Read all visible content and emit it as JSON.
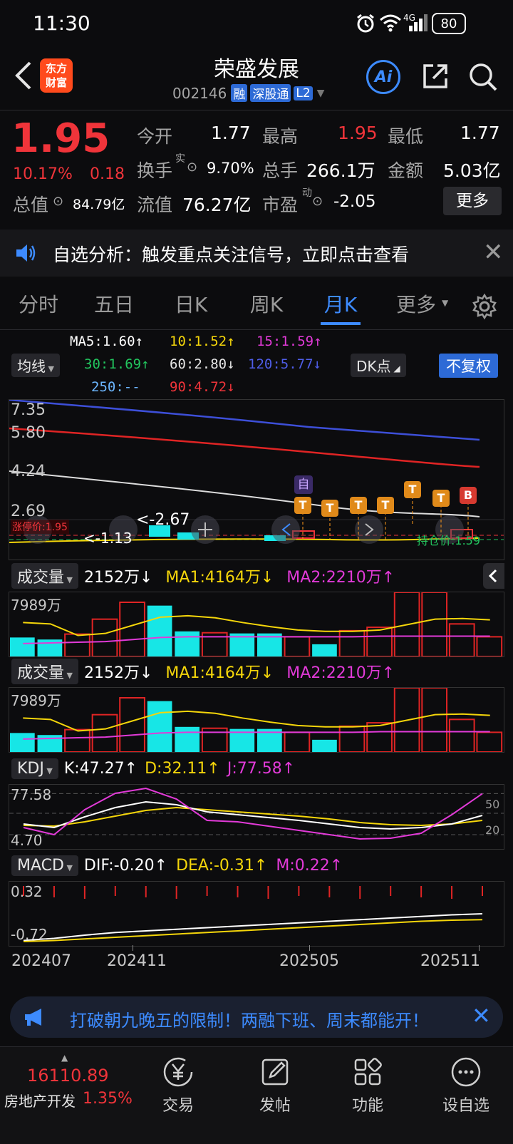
{
  "status": {
    "time": "11:30",
    "battery": "80",
    "network": "4G"
  },
  "header": {
    "logo_line1": "东方",
    "logo_line2": "财富",
    "title": "荣盛发展",
    "code": "002146",
    "tags": [
      "融",
      "深股通",
      "L2"
    ],
    "ai_label": "Ai"
  },
  "quote": {
    "price": "1.95",
    "change_pct": "10.17%",
    "change": "0.18",
    "open_label": "今开",
    "open": "1.77",
    "high_label": "最高",
    "high": "1.95",
    "low_label": "最低",
    "low": "1.77",
    "turnover_label": "换手",
    "turnover_sup": "实",
    "turnover": "9.70%",
    "volume_label": "总手",
    "volume": "266.1万",
    "amount_label": "金额",
    "amount": "5.03亿",
    "mktcap_label": "总值",
    "mktcap": "84.79亿",
    "float_label": "流值",
    "float": "76.27亿",
    "pe_label": "市盈",
    "pe_sup": "动",
    "pe": "-2.05",
    "more_button": "更多"
  },
  "notice": {
    "text": "自选分析：触发重点关注信号，立即点击查看"
  },
  "tabs": [
    {
      "label": "分时"
    },
    {
      "label": "五日"
    },
    {
      "label": "日K"
    },
    {
      "label": "周K"
    },
    {
      "label": "月K"
    },
    {
      "label": "更多"
    }
  ],
  "ma": {
    "button": "均线",
    "ma5": "MA5:1.60↑",
    "ma10": "10:1.52↑",
    "ma15": "15:1.59↑",
    "ma30": "30:1.69↑",
    "ma60": "60:2.80↓",
    "ma120": "120:5.77↓",
    "ma250": "250:--",
    "ma90": "90:4.72↓",
    "dk_button": "DK点",
    "adjust_button": "不复权"
  },
  "kchart": {
    "y_labels": [
      "7.35",
      "5.80",
      "4.24",
      "2.69"
    ],
    "min_label": "<-1.13",
    "max_label": "<-2.67",
    "limitup_label": "涨停价:1.95",
    "cost_label": "持仓价:1.59",
    "marker_zi": "自",
    "marker_b": "B",
    "marker_t": "T",
    "colors": {
      "ma120": "#3d4fd8",
      "ma90": "#e02424",
      "ma250": "#dcdcdc"
    }
  },
  "vol1": {
    "label": "成交量",
    "value": "2152万↓",
    "ma1": "MA1:4164万↓",
    "ma2": "MA2:2210万↑",
    "ymax": "7989万"
  },
  "vol2": {
    "label": "成交量",
    "value": "2152万↓",
    "ma1": "MA1:4164万↓",
    "ma2": "MA2:2210万↑",
    "ymax": "7989万"
  },
  "kdj": {
    "label": "KDJ",
    "k": "K:47.27↑",
    "d": "D:32.11↑",
    "j": "J:77.58↑",
    "ymax": "77.58",
    "ymin": "4.70",
    "l50": "50",
    "l20": "20"
  },
  "macd": {
    "label": "MACD",
    "dif": "DIF:-0.20↑",
    "dea": "DEA:-0.31↑",
    "m": "M:0.22↑",
    "ymax": "0.32",
    "ymin": "-0.72"
  },
  "xaxis": [
    "202407",
    "202411",
    "202505",
    "202511"
  ],
  "chart_data": {
    "type": "bar",
    "volume_bars": [
      {
        "value": 2800,
        "up": false
      },
      {
        "value": 2500,
        "up": false
      },
      {
        "value": 3300,
        "up": true
      },
      {
        "value": 5500,
        "up": true
      },
      {
        "value": 7989,
        "up": true
      },
      {
        "value": 7500,
        "up": false
      },
      {
        "value": 3700,
        "up": false
      },
      {
        "value": 3500,
        "up": true
      },
      {
        "value": 3400,
        "up": false
      },
      {
        "value": 3400,
        "up": false
      },
      {
        "value": 2900,
        "up": true
      },
      {
        "value": 1800,
        "up": false
      },
      {
        "value": 3800,
        "up": true
      },
      {
        "value": 4300,
        "up": true
      },
      {
        "value": 10000,
        "up": true
      },
      {
        "value": 10000,
        "up": true
      },
      {
        "value": 4800,
        "up": true
      },
      {
        "value": 2900,
        "up": true
      }
    ],
    "vol_ma1": [
      5000,
      4800,
      3100,
      3400,
      4600,
      5800,
      6000,
      5700,
      5000,
      4400,
      3900,
      3700,
      3700,
      3900,
      4700,
      5500,
      5600,
      5400
    ],
    "vol_ma2": [
      1900,
      2000,
      2100,
      2200,
      2500,
      2800,
      2900,
      2900,
      2900,
      2900,
      2900,
      2900,
      2900,
      3000,
      3000,
      3000,
      3000,
      3000
    ],
    "kdj_k": [
      35,
      30,
      45,
      58,
      66,
      62,
      52,
      48,
      44,
      40,
      35,
      30,
      28,
      30,
      35,
      47
    ],
    "kdj_d": [
      33,
      32,
      38,
      46,
      54,
      58,
      55,
      52,
      49,
      46,
      42,
      37,
      34,
      33,
      35,
      40
    ],
    "kdj_j": [
      30,
      20,
      55,
      78,
      85,
      70,
      40,
      38,
      32,
      26,
      20,
      14,
      15,
      22,
      48,
      77.58
    ],
    "macd_dif": [
      -0.7,
      -0.66,
      -0.6,
      -0.55,
      -0.52,
      -0.49,
      -0.46,
      -0.43,
      -0.4,
      -0.37,
      -0.34,
      -0.31,
      -0.28,
      -0.25,
      -0.22,
      -0.2
    ],
    "macd_dea": [
      -0.72,
      -0.7,
      -0.67,
      -0.64,
      -0.61,
      -0.58,
      -0.55,
      -0.52,
      -0.49,
      -0.46,
      -0.43,
      -0.4,
      -0.37,
      -0.34,
      -0.32,
      -0.31
    ]
  },
  "banner": {
    "text": "打破朝九晚五的限制！两融下班、周末都能开！"
  },
  "bottom": {
    "index_value": "16110.89",
    "index_name": "房地产开发",
    "index_change": "1.35%",
    "nav": [
      {
        "label": "交易"
      },
      {
        "label": "发帖"
      },
      {
        "label": "功能"
      },
      {
        "label": "设自选"
      }
    ]
  }
}
